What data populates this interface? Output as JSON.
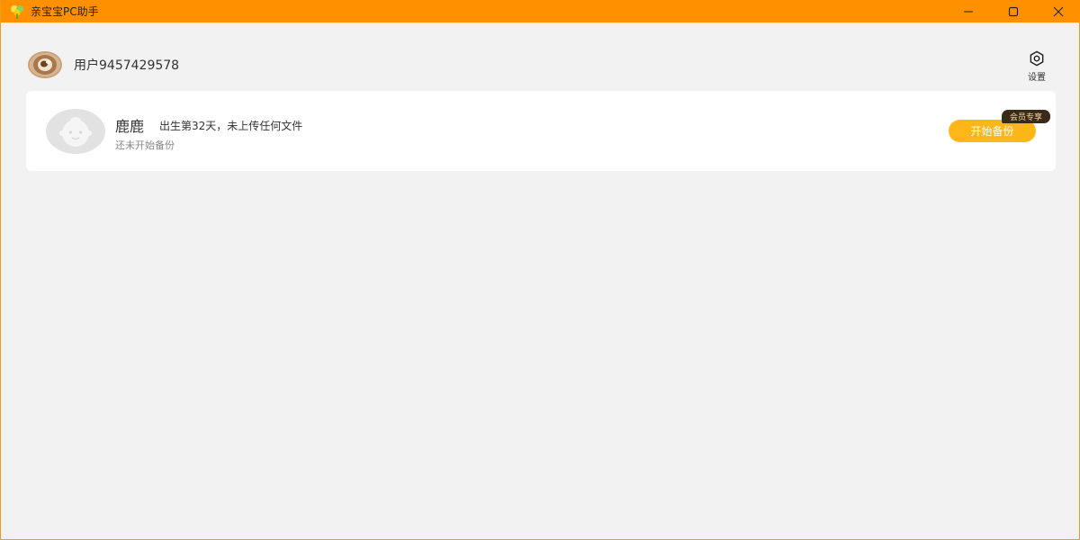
{
  "window": {
    "title": "亲宝宝PC助手",
    "accent_color": "#ff9100",
    "controls": {
      "minimize_icon": "minimize-icon",
      "maximize_icon": "maximize-icon",
      "close_icon": "close-icon"
    }
  },
  "user": {
    "name": "用户9457429578",
    "avatar_icon": "user-avatar"
  },
  "settings": {
    "label": "设置",
    "icon": "gear-icon"
  },
  "baby_card": {
    "name": "鹿鹿",
    "info": "出生第32天，未上传任何文件",
    "status": "还未开始备份",
    "backup_button_label": "开始备份",
    "vip_badge": "会员专享",
    "button_color": "#ffb619"
  }
}
